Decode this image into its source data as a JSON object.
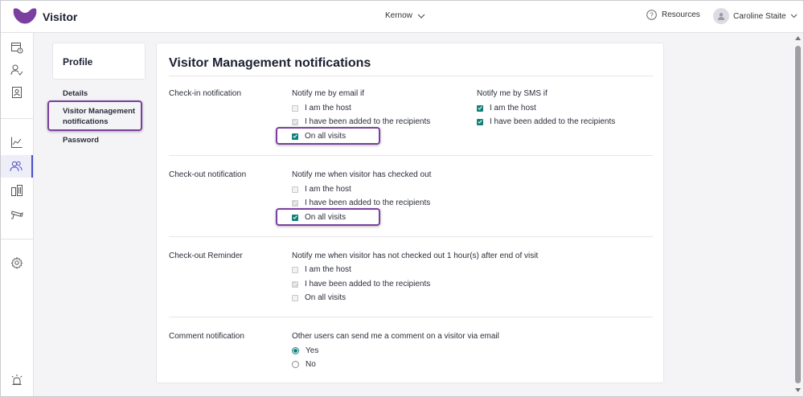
{
  "app": {
    "name": "Visitor",
    "brand_color": "#7b3fa0"
  },
  "header": {
    "site": "Kernow",
    "resources": "Resources",
    "user": "Caroline Staite"
  },
  "rail": {
    "icons": [
      "calendar-clock-icon",
      "user-check-icon",
      "contact-card-icon",
      "chart-line-icon",
      "users-icon",
      "buildings-icon",
      "camera-icon",
      "settings-icon",
      "alarm-icon"
    ],
    "active": "users-icon"
  },
  "sidebar": {
    "title": "Profile",
    "links": [
      "Details",
      "Visitor Management notifications",
      "Password"
    ],
    "active_index": 1
  },
  "main": {
    "title": "Visitor Management notifications",
    "checkin": {
      "label": "Check-in notification",
      "email_head": "Notify me by email if",
      "email_opts": [
        {
          "label": "I am the host",
          "state": "disabled"
        },
        {
          "label": "I have been added to the recipients",
          "state": "disabled-checked"
        },
        {
          "label": "On all visits",
          "state": "checked"
        }
      ],
      "sms_head": "Notify me by SMS if",
      "sms_opts": [
        {
          "label": "I am the host",
          "state": "checked"
        },
        {
          "label": "I have been added to the recipients",
          "state": "checked"
        }
      ]
    },
    "checkout": {
      "label": "Check-out notification",
      "head": "Notify me when visitor has checked out",
      "opts": [
        {
          "label": "I am the host",
          "state": "disabled"
        },
        {
          "label": "I have been added to the recipients",
          "state": "disabled-checked"
        },
        {
          "label": "On all visits",
          "state": "checked"
        }
      ]
    },
    "reminder": {
      "label": "Check-out Reminder",
      "head": "Notify me when visitor has not checked out 1 hour(s) after end of visit",
      "opts": [
        {
          "label": "I am the host",
          "state": "disabled"
        },
        {
          "label": "I have been added to the recipients",
          "state": "disabled-checked"
        },
        {
          "label": "On all visits",
          "state": "disabled"
        }
      ]
    },
    "comment": {
      "label": "Comment notification",
      "head": "Other users can send me a comment on a visitor via email",
      "opts": [
        {
          "label": "Yes",
          "selected": true
        },
        {
          "label": "No",
          "selected": false
        }
      ]
    }
  }
}
